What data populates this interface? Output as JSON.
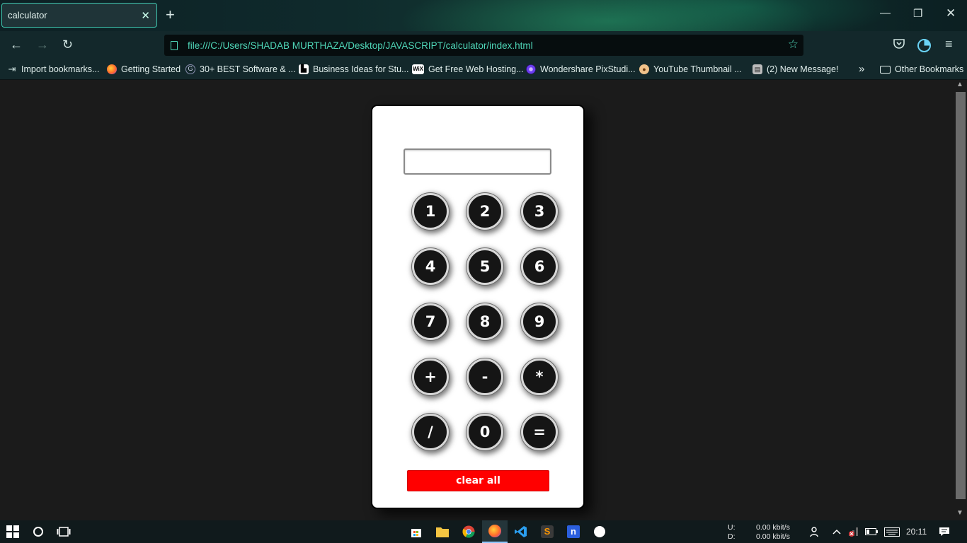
{
  "browser": {
    "tab": {
      "title": "calculator"
    },
    "url": "file:///C:/Users/SHADAB MURTHAZA/Desktop/JAVASCRIPT/calculator/index.html",
    "bookmarks": [
      {
        "label": "Import bookmarks...",
        "icon": "import-icon",
        "color": "#cfe3e0"
      },
      {
        "label": "Getting Started",
        "icon": "firefox-icon",
        "color": "#ff7139"
      },
      {
        "label": "30+ BEST Software & ...",
        "icon": "site-icon",
        "color": "#8a8fb0"
      },
      {
        "label": "Business Ideas for Stu...",
        "icon": "site-icon",
        "color": "#ffffff"
      },
      {
        "label": "Get Free Web Hosting...",
        "icon": "wix-icon",
        "color": "#ffffff"
      },
      {
        "label": "Wondershare PixStudi...",
        "icon": "pixstudio-icon",
        "color": "#6a3df0"
      },
      {
        "label": "YouTube Thumbnail ...",
        "icon": "monkey-icon",
        "color": "#f0c28a"
      },
      {
        "label": "(2) New Message!",
        "icon": "clapper-icon",
        "color": "#cccccc"
      }
    ],
    "other_bookmarks": "Other Bookmarks"
  },
  "calculator": {
    "display_value": "",
    "keys": [
      "1",
      "2",
      "3",
      "4",
      "5",
      "6",
      "7",
      "8",
      "9",
      "+",
      "-",
      "*",
      "/",
      "0",
      "="
    ],
    "clear_label": "clear all"
  },
  "taskbar": {
    "network_up_label": "U:",
    "network_up": "0.00 kbit/s",
    "network_down_label": "D:",
    "network_down": "0.00 kbit/s",
    "clock": "20:11"
  },
  "colors": {
    "accent": "#4fd6b8",
    "page_background": "#1b1b1b",
    "key_background": "#151515",
    "clear_button": "#ff0000"
  }
}
